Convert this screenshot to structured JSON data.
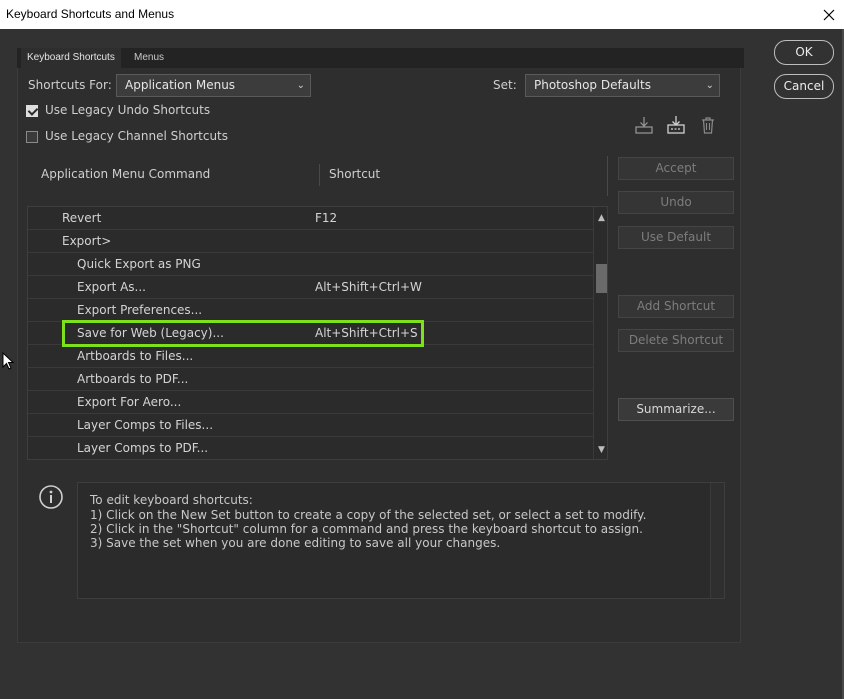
{
  "window": {
    "title": "Keyboard Shortcuts and Menus"
  },
  "tabs": [
    {
      "label": "Keyboard Shortcuts"
    },
    {
      "label": "Menus"
    }
  ],
  "shortcuts_for": {
    "label": "Shortcuts For:",
    "value": "Application Menus"
  },
  "set": {
    "label": "Set:",
    "value": "Photoshop Defaults"
  },
  "options": {
    "legacy_undo": {
      "label": "Use Legacy Undo Shortcuts",
      "checked": true
    },
    "legacy_channel": {
      "label": "Use Legacy Channel Shortcuts",
      "checked": false
    }
  },
  "columns": {
    "command": "Application Menu Command",
    "shortcut": "Shortcut"
  },
  "rows": [
    {
      "command": "Revert",
      "shortcut": "F12",
      "indent": 0
    },
    {
      "command": "Export>",
      "shortcut": "",
      "indent": 0
    },
    {
      "command": "Quick Export as PNG",
      "shortcut": "",
      "indent": 1
    },
    {
      "command": "Export As...",
      "shortcut": "Alt+Shift+Ctrl+W",
      "indent": 1
    },
    {
      "command": "Export Preferences...",
      "shortcut": "",
      "indent": 1
    },
    {
      "command": "Save for Web (Legacy)...",
      "shortcut": "Alt+Shift+Ctrl+S",
      "indent": 1
    },
    {
      "command": "Artboards to Files...",
      "shortcut": "",
      "indent": 1
    },
    {
      "command": "Artboards to PDF...",
      "shortcut": "",
      "indent": 1
    },
    {
      "command": "Export For Aero...",
      "shortcut": "",
      "indent": 1
    },
    {
      "command": "Layer Comps to Files...",
      "shortcut": "",
      "indent": 1
    },
    {
      "command": "Layer Comps to PDF...",
      "shortcut": "",
      "indent": 1
    }
  ],
  "buttons": {
    "ok": "OK",
    "cancel": "Cancel",
    "accept": "Accept",
    "undo": "Undo",
    "use_default": "Use Default",
    "add_shortcut": "Add Shortcut",
    "delete_shortcut": "Delete Shortcut",
    "summarize": "Summarize..."
  },
  "info": {
    "lines": [
      "To edit keyboard shortcuts:",
      "1) Click on the New Set button to create a copy of the selected set, or select a set to modify.",
      "2) Click in the \"Shortcut\" column for a command and press the keyboard shortcut to assign.",
      "3) Save the set when you are done editing to save all your changes."
    ]
  },
  "colors": {
    "highlight": "#7fe11c",
    "background": "#323232"
  },
  "icons": [
    "close-icon",
    "save-set-icon",
    "new-set-icon",
    "delete-set-icon",
    "info-icon",
    "chevron-down-icon",
    "scroll-up-icon",
    "scroll-down-icon",
    "mouse-cursor-icon"
  ]
}
